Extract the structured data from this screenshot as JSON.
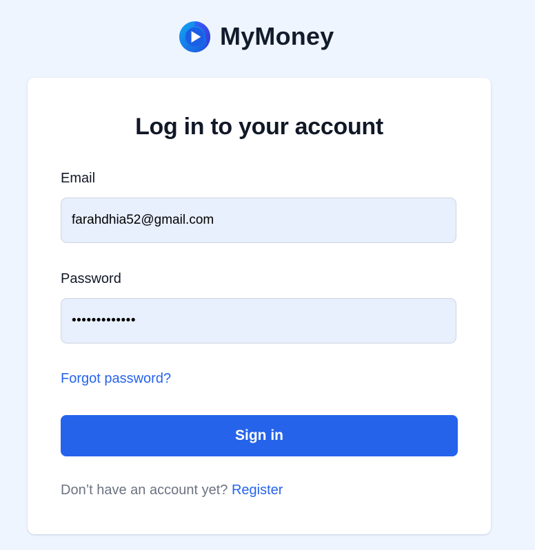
{
  "brand": {
    "name": "MyMoney",
    "logo_icon": "play-icon",
    "logo_colors": [
      "#1d6cf0",
      "#12a8f2",
      "#3b2fd0"
    ]
  },
  "login": {
    "title": "Log in to your account",
    "email_label": "Email",
    "email_value": "farahdhia52@gmail.com",
    "password_label": "Password",
    "password_value": "farahdhia52!!",
    "forgot_label": "Forgot password?",
    "signin_label": "Sign in",
    "register_prompt": "Don’t have an account yet?",
    "register_label": "Register"
  },
  "colors": {
    "background": "#eef5fe",
    "accent": "#2563eb",
    "field_fill": "#e8effd",
    "heading": "#111827",
    "muted": "#6b7280"
  }
}
